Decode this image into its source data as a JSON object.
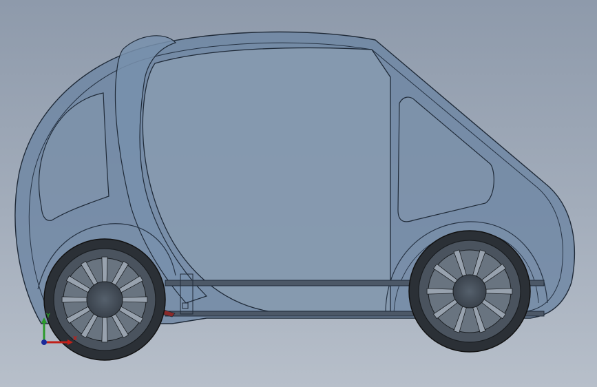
{
  "viewport": {
    "background_top": "#8e9aab",
    "background_bottom": "#b7bfca"
  },
  "model": {
    "body_color": "#6e86a3",
    "body_edge_color": "#1f2a38",
    "window_color": "#7f93ab",
    "wheel_color": "#3e4650",
    "tire_color": "#2b3036",
    "spoke_color": "#98a2ae",
    "frame_color": "#4c5867",
    "brake_color": "#8a2a2a"
  },
  "triad": {
    "x_label": "X",
    "y_label": "Y",
    "x_color": "#c0201a",
    "y_color": "#2a9a2a",
    "z_color": "#1a2a9a",
    "icons": [
      "x-axis-arrow-icon",
      "y-axis-arrow-icon",
      "z-axis-dot-icon"
    ]
  }
}
